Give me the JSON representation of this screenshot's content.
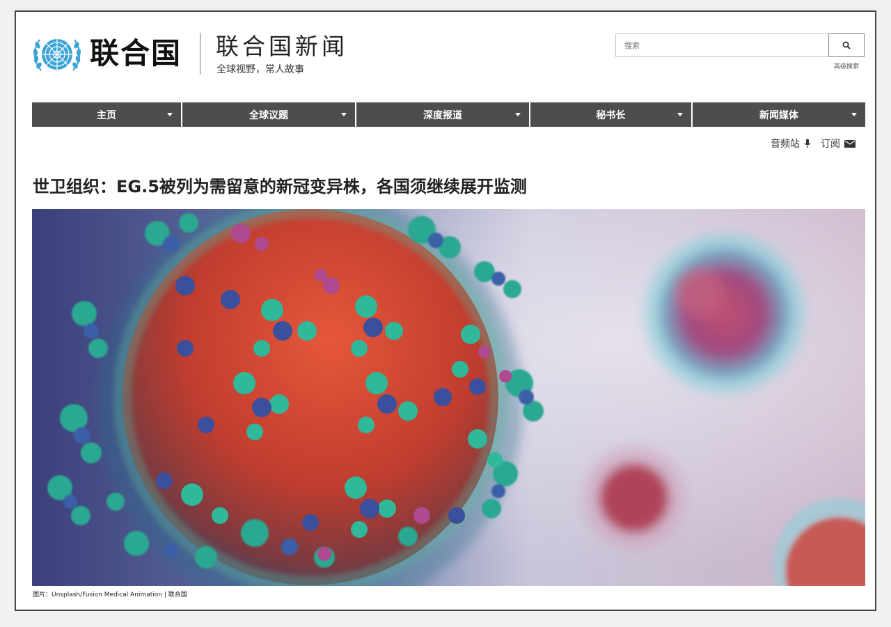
{
  "branding": {
    "org_name": "联合国",
    "site_title": "联合国新闻",
    "tagline": "全球视野，常人故事"
  },
  "search": {
    "placeholder": "搜索",
    "button_icon": "search-icon",
    "advanced_label": "高级搜索"
  },
  "nav": {
    "items": [
      {
        "label": "主页"
      },
      {
        "label": "全球议题"
      },
      {
        "label": "深度报道"
      },
      {
        "label": "秘书长"
      },
      {
        "label": "新闻媒体"
      }
    ]
  },
  "utility": {
    "audio_label": "音频站",
    "audio_icon": "microphone-icon",
    "subscribe_label": "订阅",
    "subscribe_icon": "envelope-icon"
  },
  "article": {
    "headline": "世卫组织：EG.5被列为需留意的新冠变异株，各国须继续展开监测",
    "image_caption": "图片：Unsplash/Fusion Medical Animation | 联合国"
  },
  "colors": {
    "nav_bg": "#4d4d4d",
    "un_blue": "#3ba4d6",
    "frame_border": "#444444"
  }
}
